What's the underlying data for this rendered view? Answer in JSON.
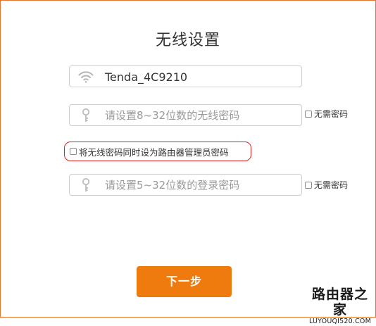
{
  "page": {
    "title": "无线设置"
  },
  "wifi": {
    "ssid": "Tenda_4C9210"
  },
  "wifi_password": {
    "placeholder": "请设置8~32位数的无线密码"
  },
  "no_password_label": "无需密码",
  "same_as_admin_label": "将无线密码同时设为路由器管理员密码",
  "login_password": {
    "placeholder": "请设置5~32位数的登录密码"
  },
  "next_button": "下一步",
  "watermark": {
    "cn": "路由器之家",
    "en": "LUYOUQI520.COM"
  },
  "colors": {
    "accent": "#ef7a0e",
    "highlight": "#e02020",
    "border": "#e8752e"
  },
  "icons": [
    "wifi-icon",
    "key-icon",
    "key-icon"
  ]
}
